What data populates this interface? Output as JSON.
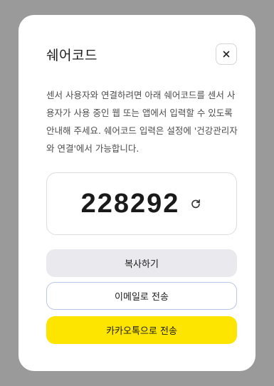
{
  "dialog": {
    "title": "쉐어코드",
    "close_icon": "close-icon",
    "description": "센서 사용자와 연결하려면 아래 쉐어코드를 센서 사용자가 사용 중인 웹 또는 앱에서 입력할 수 있도록 안내해 주세요. 쉐어코드 입력은 설정에 '건강관리자와 연결'에서 가능합니다.",
    "share_code": "228292",
    "refresh_icon": "refresh-icon",
    "buttons": {
      "copy_label": "복사하기",
      "email_label": "이메일로 전송",
      "kakao_label": "카카오톡으로 전송"
    }
  },
  "colors": {
    "backdrop": "#9a9a9a",
    "modal_bg": "#ffffff",
    "copy_button_bg": "#e9e9ee",
    "email_button_border": "#b9c7e6",
    "kakao_button_bg": "#fee500"
  }
}
